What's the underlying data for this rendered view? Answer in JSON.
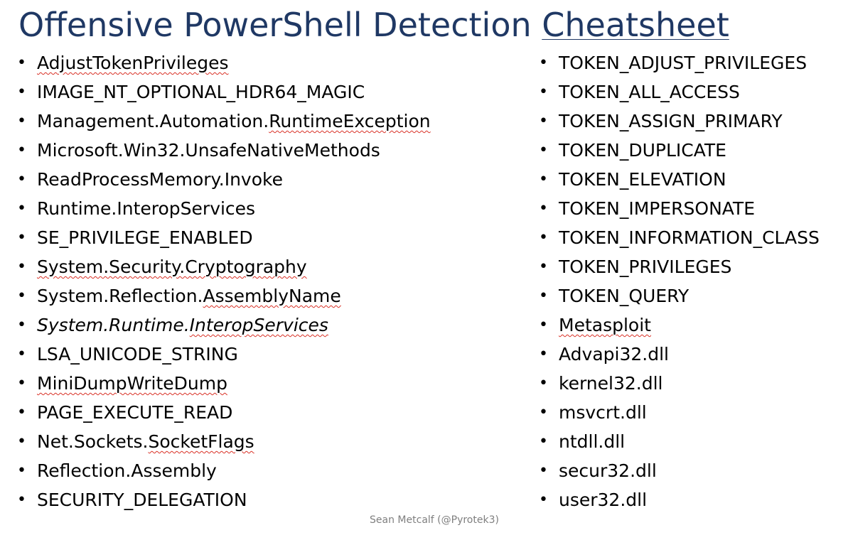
{
  "title_prefix": "Offensive PowerShell Detection ",
  "title_suffix": "Cheatsheet",
  "left_column": [
    {
      "parts": [
        "AdjustTokenPrivileges"
      ],
      "flags": [
        "squig"
      ]
    },
    {
      "parts": [
        "IMAGE_NT_OPTIONAL_HDR64_MAGIC"
      ],
      "flags": [
        ""
      ]
    },
    {
      "parts": [
        "Management.Automation.",
        "RuntimeException"
      ],
      "flags": [
        "",
        "squig"
      ]
    },
    {
      "parts": [
        "Microsoft.Win32.UnsafeNativeMethods"
      ],
      "flags": [
        ""
      ]
    },
    {
      "parts": [
        "ReadProcessMemory.Invoke"
      ],
      "flags": [
        ""
      ]
    },
    {
      "parts": [
        "Runtime.InteropServices"
      ],
      "flags": [
        ""
      ]
    },
    {
      "parts": [
        "SE_PRIVILEGE_ENABLED"
      ],
      "flags": [
        ""
      ]
    },
    {
      "parts": [
        "System.Security.Cryptography"
      ],
      "flags": [
        "squig"
      ]
    },
    {
      "parts": [
        "System.Reflection.",
        "AssemblyName"
      ],
      "flags": [
        "",
        "squig"
      ]
    },
    {
      "parts": [
        "System.Runtime.",
        "InteropServices"
      ],
      "flags": [
        "italic",
        "italic squig"
      ]
    },
    {
      "parts": [
        "LSA_UNICODE_STRING"
      ],
      "flags": [
        ""
      ]
    },
    {
      "parts": [
        "MiniDumpWriteDump"
      ],
      "flags": [
        "squig"
      ]
    },
    {
      "parts": [
        "PAGE_EXECUTE_READ"
      ],
      "flags": [
        ""
      ]
    },
    {
      "parts": [
        "Net.Sockets.",
        "SocketFlags"
      ],
      "flags": [
        "",
        "squig"
      ]
    },
    {
      "parts": [
        "Reflection.Assembly"
      ],
      "flags": [
        ""
      ]
    },
    {
      "parts": [
        "SECURITY_DELEGATION"
      ],
      "flags": [
        ""
      ]
    }
  ],
  "right_column": [
    {
      "parts": [
        "TOKEN_ADJUST_PRIVILEGES"
      ],
      "flags": [
        ""
      ]
    },
    {
      "parts": [
        "TOKEN_ALL_ACCESS"
      ],
      "flags": [
        ""
      ]
    },
    {
      "parts": [
        "TOKEN_ASSIGN_PRIMARY"
      ],
      "flags": [
        ""
      ]
    },
    {
      "parts": [
        "TOKEN_DUPLICATE"
      ],
      "flags": [
        ""
      ]
    },
    {
      "parts": [
        "TOKEN_ELEVATION"
      ],
      "flags": [
        ""
      ]
    },
    {
      "parts": [
        "TOKEN_IMPERSONATE"
      ],
      "flags": [
        ""
      ]
    },
    {
      "parts": [
        "TOKEN_INFORMATION_CLASS"
      ],
      "flags": [
        ""
      ]
    },
    {
      "parts": [
        "TOKEN_PRIVILEGES"
      ],
      "flags": [
        ""
      ]
    },
    {
      "parts": [
        "TOKEN_QUERY"
      ],
      "flags": [
        ""
      ]
    },
    {
      "parts": [
        "Metasploit"
      ],
      "flags": [
        "squig"
      ]
    },
    {
      "parts": [
        "Advapi32.dll"
      ],
      "flags": [
        ""
      ]
    },
    {
      "parts": [
        "kernel32.dll"
      ],
      "flags": [
        ""
      ]
    },
    {
      "parts": [
        "msvcrt.dll"
      ],
      "flags": [
        ""
      ]
    },
    {
      "parts": [
        "ntdll.dll"
      ],
      "flags": [
        ""
      ]
    },
    {
      "parts": [
        "secur32.dll"
      ],
      "flags": [
        ""
      ]
    },
    {
      "parts": [
        "user32.dll"
      ],
      "flags": [
        ""
      ]
    }
  ],
  "bullet": "•",
  "footer": "Sean Metcalf (@Pyrotek3)",
  "colors": {
    "title": "#1f3864",
    "text": "#000000",
    "spellcheck_underline": "#d93025",
    "footer": "#7f7f7f"
  }
}
